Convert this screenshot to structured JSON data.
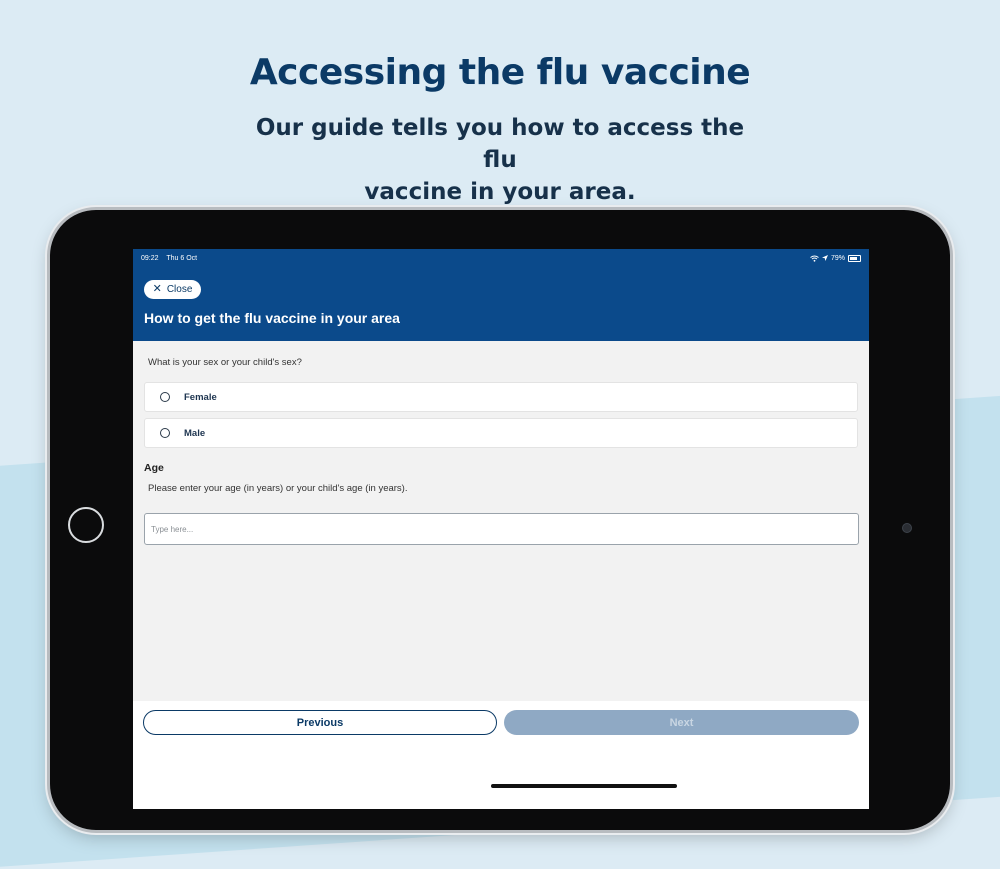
{
  "promo": {
    "headline": "Accessing the flu vaccine",
    "subhead_line1": "Our guide tells you how to access the flu",
    "subhead_line2": "vaccine in your area."
  },
  "status_bar": {
    "time": "09:22",
    "date": "Thu 6 Oct",
    "battery": "79%"
  },
  "header": {
    "close_label": "Close",
    "title": "How to get the flu vaccine in your area"
  },
  "form": {
    "sex_question": "What is your sex or your child's sex?",
    "sex_options": [
      {
        "label": "Female",
        "selected": false
      },
      {
        "label": "Male",
        "selected": false
      }
    ],
    "age_heading": "Age",
    "age_help": "Please enter your age (in years) or your child's age (in years).",
    "age_value": "",
    "age_placeholder": "Type here..."
  },
  "footer": {
    "previous_label": "Previous",
    "next_label": "Next"
  },
  "colors": {
    "brand_blue": "#0b4a8b",
    "headline_blue": "#0b3a66",
    "next_disabled": "#8fa9c4",
    "background": "#dcebf4"
  },
  "icons": {
    "close": "close-icon",
    "wifi": "wifi-icon",
    "location": "location-arrow-icon",
    "battery": "battery-icon"
  }
}
